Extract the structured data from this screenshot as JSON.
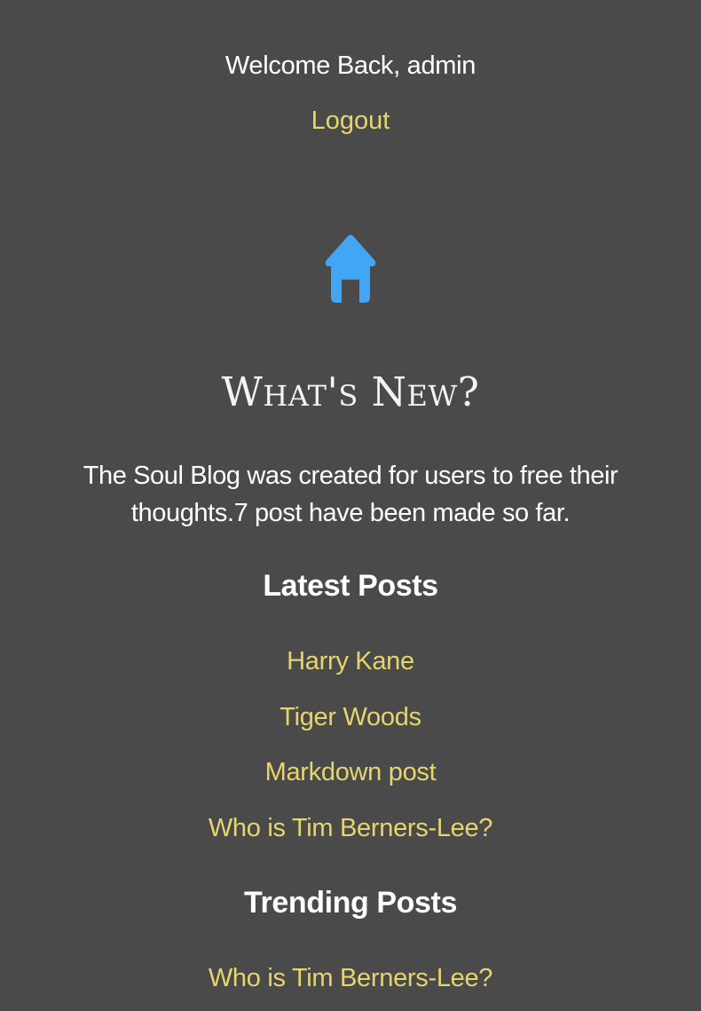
{
  "header": {
    "welcome_text": "Welcome Back, admin",
    "logout_label": "Logout"
  },
  "home_icon": {
    "name": "home-icon",
    "color": "#42a5f5"
  },
  "main": {
    "heading": "What's New?",
    "intro": "The Soul Blog was created for users to free their thoughts.7 post have been made so far."
  },
  "latest_posts": {
    "title": "Latest Posts",
    "items": [
      {
        "label": "Harry Kane"
      },
      {
        "label": "Tiger Woods"
      },
      {
        "label": "Markdown post"
      },
      {
        "label": "Who is Tim Berners-Lee?"
      }
    ]
  },
  "trending_posts": {
    "title": "Trending Posts",
    "items": [
      {
        "label": "Who is Tim Berners-Lee?"
      }
    ]
  },
  "colors": {
    "background": "#4a4a4a",
    "link": "#e6d56c",
    "text": "#ffffff",
    "icon": "#42a5f5"
  }
}
